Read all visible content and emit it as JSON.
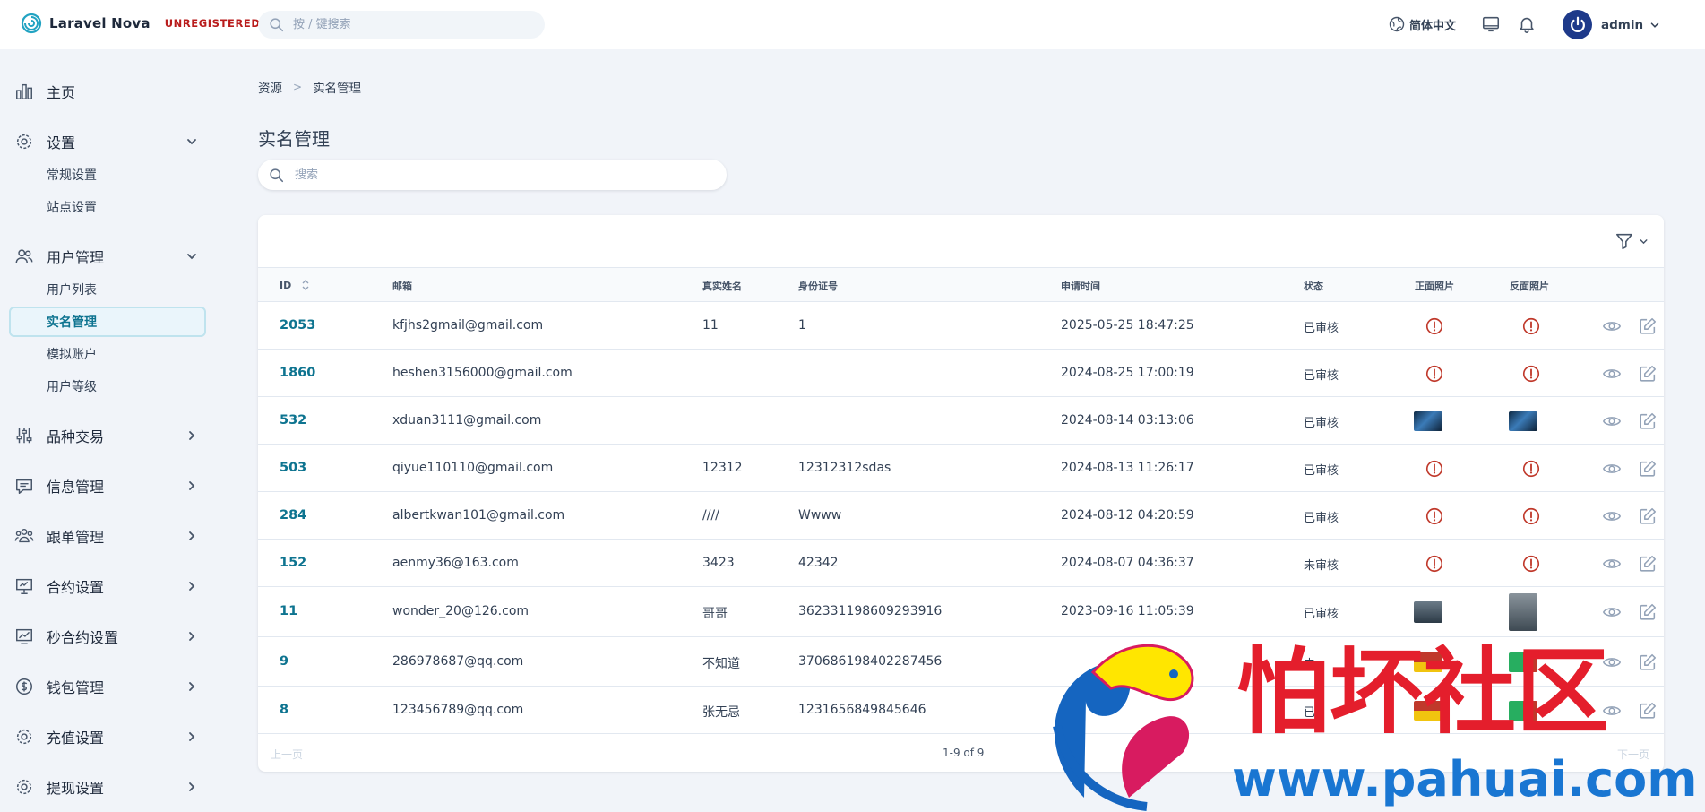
{
  "app": {
    "name": "Laravel Nova",
    "badge": "UNREGISTERED",
    "search_placeholder": "按 / 键搜索",
    "language": "简体中文",
    "user": "admin",
    "accent": "#0e7490"
  },
  "sidebar": {
    "groups": [
      {
        "label": "主页",
        "icon": "bar-chart-icon"
      },
      {
        "label": "设置",
        "icon": "gear-icon",
        "expanded": true,
        "items": [
          "常规设置",
          "站点设置"
        ]
      },
      {
        "label": "用户管理",
        "icon": "users-icon",
        "expanded": true,
        "items": [
          "用户列表",
          "实名管理",
          "模拟账户",
          "用户等级"
        ],
        "active": "实名管理"
      },
      {
        "label": "品种交易",
        "icon": "sliders-icon"
      },
      {
        "label": "信息管理",
        "icon": "message-icon"
      },
      {
        "label": "跟单管理",
        "icon": "user-group-icon"
      },
      {
        "label": "合约设置",
        "icon": "presentation-icon"
      },
      {
        "label": "秒合约设置",
        "icon": "trend-chart-icon"
      },
      {
        "label": "钱包管理",
        "icon": "dollar-icon"
      },
      {
        "label": "充值设置",
        "icon": "gear-icon"
      },
      {
        "label": "提现设置",
        "icon": "gear-icon"
      }
    ]
  },
  "breadcrumb": {
    "root": "资源",
    "current": "实名管理"
  },
  "page": {
    "title": "实名管理",
    "search_placeholder": "搜索"
  },
  "table": {
    "columns": [
      "ID",
      "邮箱",
      "真实姓名",
      "身份证号",
      "申请时间",
      "状态",
      "正面照片",
      "反面照片"
    ],
    "rows": [
      {
        "id": "2053",
        "email": "kfjhs2gmail@gmail.com",
        "name": "11",
        "idno": "1",
        "time": "2025-05-25 18:47:25",
        "status": "已审核",
        "front": "missing",
        "back": "missing"
      },
      {
        "id": "1860",
        "email": "heshen3156000@gmail.com",
        "name": "",
        "idno": "",
        "time": "2024-08-25 17:00:19",
        "status": "已审核",
        "front": "missing",
        "back": "missing"
      },
      {
        "id": "532",
        "email": "xduan3111@gmail.com",
        "name": "",
        "idno": "",
        "time": "2024-08-14 03:13:06",
        "status": "已审核",
        "front": "image",
        "back": "image"
      },
      {
        "id": "503",
        "email": "qiyue110110@gmail.com",
        "name": "12312",
        "idno": "12312312sdas",
        "time": "2024-08-13 11:26:17",
        "status": "已审核",
        "front": "missing",
        "back": "missing"
      },
      {
        "id": "284",
        "email": "albertkwan101@gmail.com",
        "name": "////",
        "idno": "Wwww",
        "time": "2024-08-12 04:20:59",
        "status": "已审核",
        "front": "missing",
        "back": "missing"
      },
      {
        "id": "152",
        "email": "aenmy36@163.com",
        "name": "3423",
        "idno": "42342",
        "time": "2024-08-07 04:36:37",
        "status": "未审核",
        "front": "missing",
        "back": "missing"
      },
      {
        "id": "11",
        "email": "wonder_20@126.com",
        "name": "哥哥",
        "idno": "362331198609293916",
        "time": "2023-09-16 11:05:39",
        "status": "已审核",
        "front": "image",
        "back": "image"
      },
      {
        "id": "9",
        "email": "286978687@qq.com",
        "name": "不知道",
        "idno": "370686198402287456",
        "time": "",
        "status": "未",
        "front": "image",
        "back": "image"
      },
      {
        "id": "8",
        "email": "123456789@qq.com",
        "name": "张无忌",
        "idno": "1231656849845646",
        "time": "",
        "status": "已",
        "front": "image",
        "back": "image"
      }
    ]
  },
  "pagination": {
    "prev": "上一页",
    "next": "下一页",
    "info": "1-9 of 9"
  },
  "watermark": {
    "text": "怕坏社区",
    "url": "www.pahuai.com"
  }
}
